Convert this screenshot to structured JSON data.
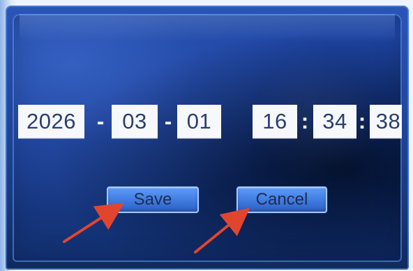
{
  "datetime_setting": {
    "date": {
      "year": "2026",
      "month": "03",
      "day": "01",
      "separator": "-"
    },
    "time": {
      "hour": "16",
      "minute": "34",
      "second": "38",
      "separator": ":"
    },
    "buttons": {
      "save_label": "Save",
      "cancel_label": "Cancel"
    }
  },
  "colors": {
    "screen_background": "#1f46a5",
    "field_background": "#f7f8fb",
    "field_text": "#2a3f6b",
    "button_fill": "#3f7ae0",
    "button_border": "#a7c8ff",
    "annotation_arrow": "#e2452e"
  }
}
